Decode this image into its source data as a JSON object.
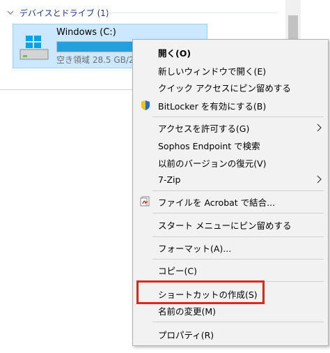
{
  "explorer": {
    "group_header": "デバイスとドライブ (1)",
    "drive": {
      "name": "Windows (C:)",
      "free_text": "空き領域 28.5 GB/2",
      "usage_fraction": 0.77
    }
  },
  "menu": {
    "items": [
      {
        "label": "開く(O)",
        "bold": true
      },
      {
        "label": "新しいウィンドウで開く(E)"
      },
      {
        "label": "クイック アクセスにピン留めする"
      },
      {
        "label": "BitLocker を有効にする(B)",
        "icon": "shield-icon"
      },
      {
        "label": "アクセスを許可する(G)",
        "submenu": true
      },
      {
        "label": "Sophos Endpoint で検索"
      },
      {
        "label": "以前のバージョンの復元(V)"
      },
      {
        "label": "7-Zip",
        "submenu": true
      },
      {
        "label": "ファイルを Acrobat で結合...",
        "icon": "acrobat-icon"
      },
      {
        "label": "スタート メニューにピン留めする"
      },
      {
        "label": "フォーマット(A)..."
      },
      {
        "label": "コピー(C)"
      },
      {
        "label": "ショートカットの作成(S)",
        "highlighted": true
      },
      {
        "label": "名前の変更(M)"
      },
      {
        "label": "プロパティ(R)"
      }
    ]
  },
  "colors": {
    "highlight_border": "#e0261d",
    "selection_bg": "#cce8ff",
    "drive_bar": "#26a0da"
  }
}
